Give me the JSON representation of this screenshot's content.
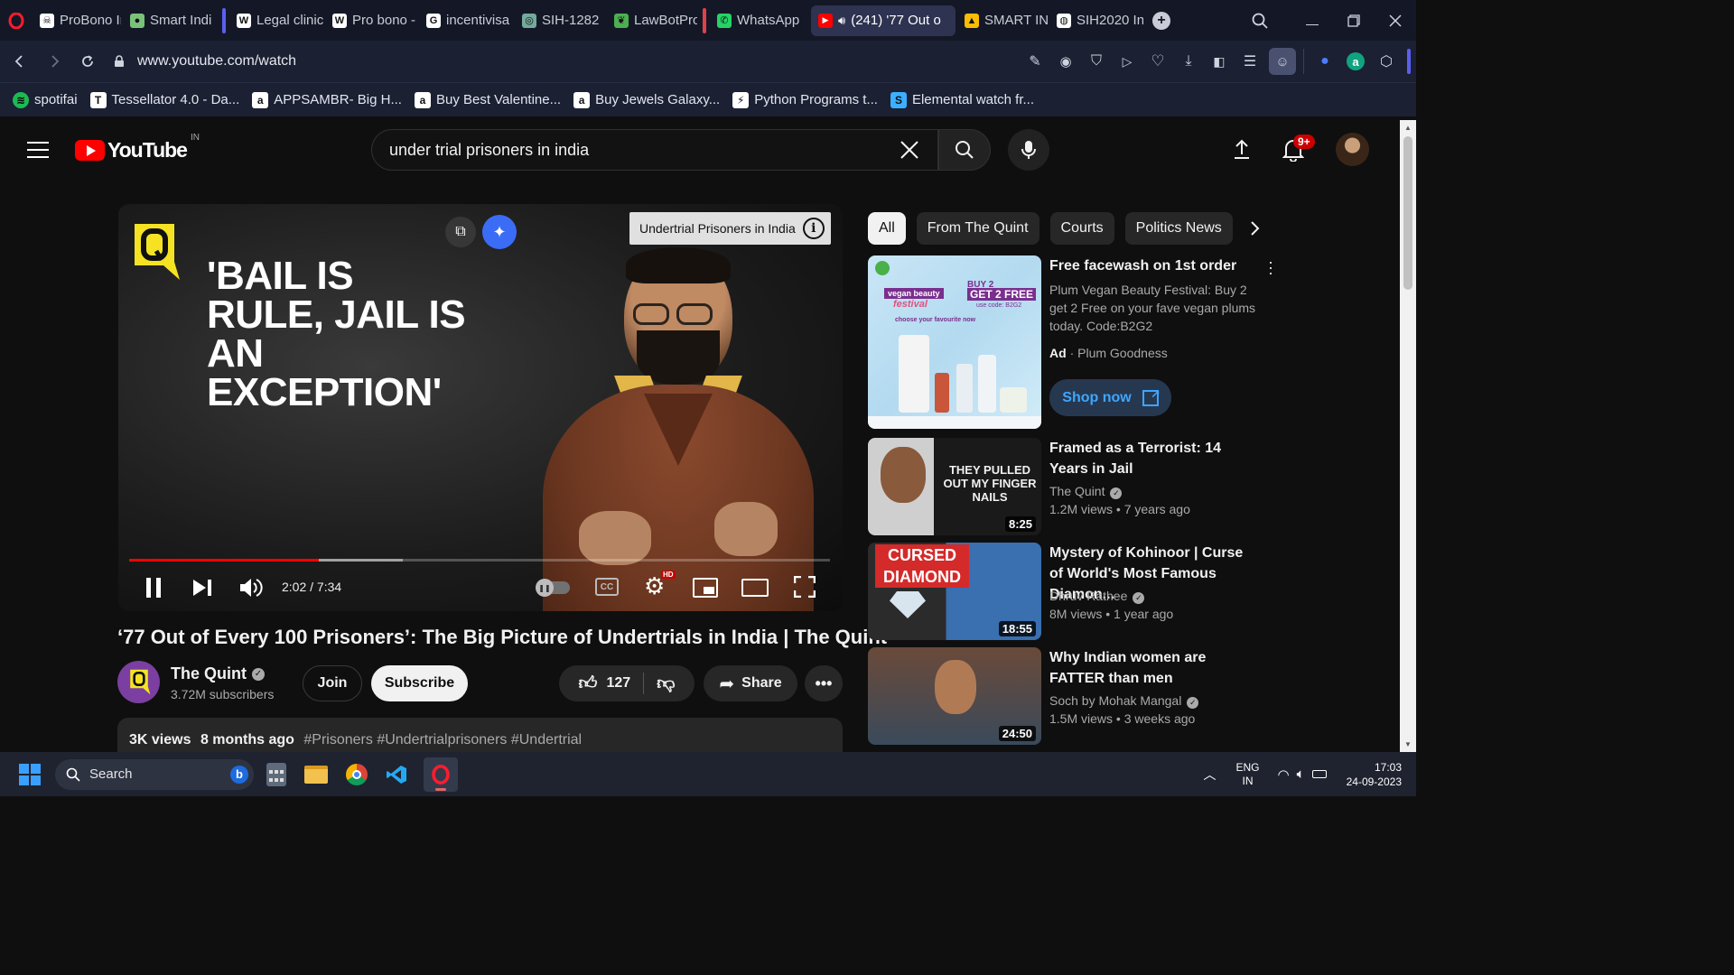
{
  "browser": {
    "tabs": [
      {
        "label": "ProBono Ir",
        "icon": "pirate-icon",
        "color": "#ffffff"
      },
      {
        "label": "Smart Indi",
        "icon": "bulb-icon",
        "color": "#7ac27a"
      },
      {
        "label": "Legal clinic",
        "icon": "wikipedia-icon",
        "color": "#ffffff"
      },
      {
        "label": "Pro bono -",
        "icon": "wikipedia-icon",
        "color": "#ffffff"
      },
      {
        "label": "incentivisa",
        "icon": "google-icon",
        "color": "#ffffff"
      },
      {
        "label": "SIH-1282",
        "icon": "chatgpt-icon",
        "color": "#74aa9c"
      },
      {
        "label": "LawBotPro",
        "icon": "leaf-icon",
        "color": "#4caf50"
      },
      {
        "label": "WhatsApp",
        "icon": "whatsapp-icon",
        "color": "#25d366"
      },
      {
        "label": "(241) '77 Out o",
        "icon": "youtube-icon",
        "color": "#ff0000"
      },
      {
        "label": "SMART IN",
        "icon": "drive-icon",
        "color": "#fbbc04"
      },
      {
        "label": "SIH2020 In",
        "icon": "globe-icon",
        "color": "#ffffff"
      }
    ],
    "url": "www.youtube.com/watch",
    "bookmarks": [
      {
        "label": "spotifai",
        "icon": "spotify-icon",
        "color": "#1db954"
      },
      {
        "label": "Tessellator 4.0 - Da...",
        "icon": "tessellator-icon",
        "color": "#ffffff"
      },
      {
        "label": "APPSAMBR- Big H...",
        "icon": "amazon-icon",
        "color": "#ffffff"
      },
      {
        "label": "Buy Best Valentine...",
        "icon": "amazon-icon",
        "color": "#ffffff"
      },
      {
        "label": "Buy Jewels Galaxy...",
        "icon": "amazon-icon",
        "color": "#ffffff"
      },
      {
        "label": "Python Programs t...",
        "icon": "python-icon",
        "color": "#ffffff"
      },
      {
        "label": "Elemental watch fr...",
        "icon": "shopify-icon",
        "color": "#3ab0ff"
      }
    ]
  },
  "youtube": {
    "logo_text": "YouTube",
    "region": "IN",
    "search_value": "under trial prisoners in india",
    "notifications": "9+",
    "video": {
      "overlay_quote": "'BAIL IS RULE, JAIL IS AN EXCEPTION'",
      "info_card": "Undertrial Prisoners in India",
      "time": "2:02 / 7:34",
      "progress": 0.27,
      "buffered": 0.39,
      "hd_badge": "HD",
      "title": "‘77 Out of Every 100 Prisoners’: The Big Picture of Undertrials in India | The Quint",
      "channel": "The Quint",
      "subscribers": "3.72M subscribers",
      "join": "Join",
      "subscribe": "Subscribe",
      "likes": "127",
      "share": "Share",
      "views": "3K views",
      "age": "8 months ago",
      "hashtags": "#Prisoners #Undertrialprisoners #Undertrial"
    },
    "chips": [
      "All",
      "From The Quint",
      "Courts",
      "Politics News"
    ],
    "ad": {
      "title": "Free facewash on 1st order",
      "desc": "Plum Vegan Beauty Festival: Buy 2 get 2 Free on your fave vegan plums today. Code:B2G2",
      "ad_label": "Ad",
      "advertiser": "Plum Goodness",
      "cta": "Shop now",
      "thumb_text_1": "vegan beauty",
      "thumb_text_2": "festival",
      "thumb_text_3": "BUY 2",
      "thumb_text_4": "GET 2 FREE",
      "thumb_text_5": "use code: B2G2",
      "thumb_text_6": "choose your favourite now"
    },
    "related": [
      {
        "title": "Framed as a Terrorist: 14 Years in Jail",
        "channel": "The Quint",
        "views": "1.2M views",
        "age": "7 years ago",
        "duration": "8:25",
        "thumb_text": "THEY PULLED OUT MY FINGER NAILS"
      },
      {
        "title": "Mystery of Kohinoor | Curse of World's Most Famous Diamon...",
        "channel": "Dhruv Rathee",
        "views": "8M views",
        "age": "1 year ago",
        "duration": "18:55",
        "thumb_text": "CURSED DIAMOND"
      },
      {
        "title": "Why Indian women are FATTER than men",
        "channel": "Soch by Mohak Mangal",
        "views": "1.5M views",
        "age": "3 weeks ago",
        "duration": "24:50",
        "thumb_text": ""
      }
    ]
  },
  "taskbar": {
    "search_label": "Search",
    "lang": "ENG",
    "region": "IN",
    "time": "17:03",
    "date": "24-09-2023"
  }
}
